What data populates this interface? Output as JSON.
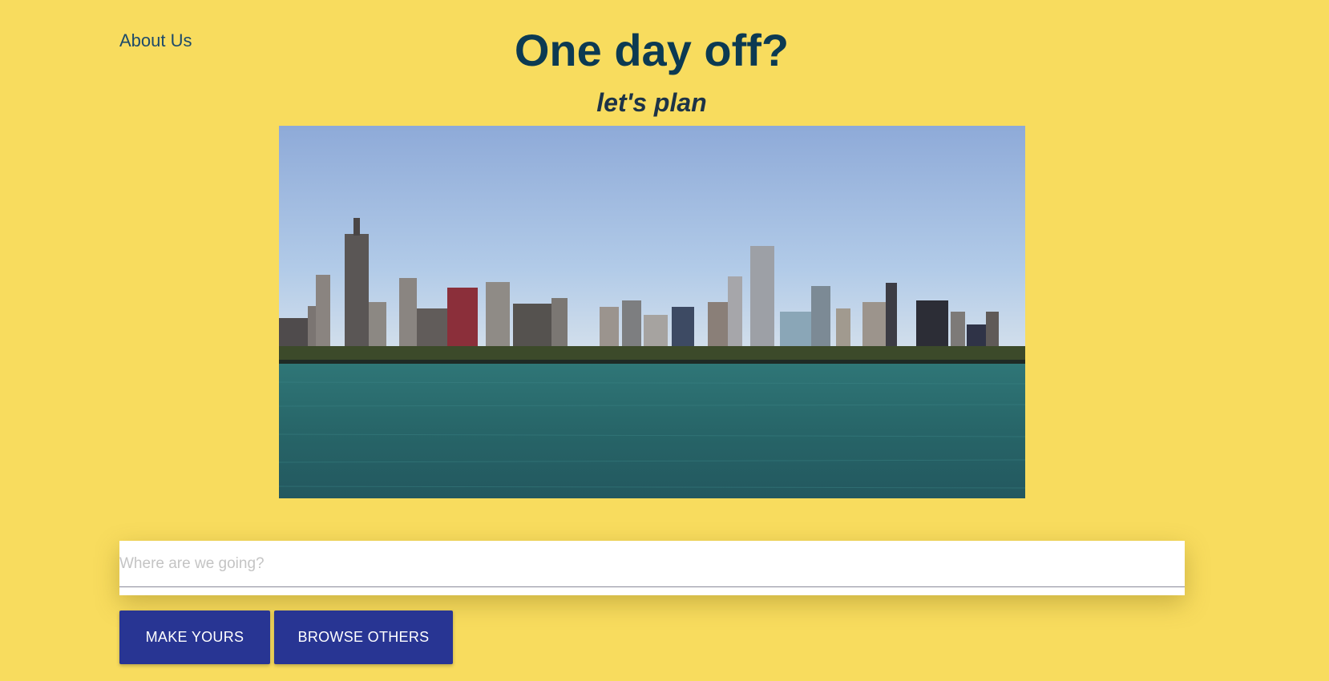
{
  "nav": {
    "about_label": "About Us"
  },
  "header": {
    "title": "One day off?",
    "subtitle": "let's plan"
  },
  "hero": {
    "image_alt": "city skyline across the lake"
  },
  "search": {
    "placeholder": "Where are we going?",
    "value": ""
  },
  "actions": {
    "make_label": "MAKE YOURS",
    "browse_label": "BROWSE OTHERS"
  },
  "colors": {
    "background": "#f8dc5e",
    "title": "#0c3a52",
    "button": "#283593",
    "water": "#2a6c70",
    "sky": "#9fbfe2"
  }
}
